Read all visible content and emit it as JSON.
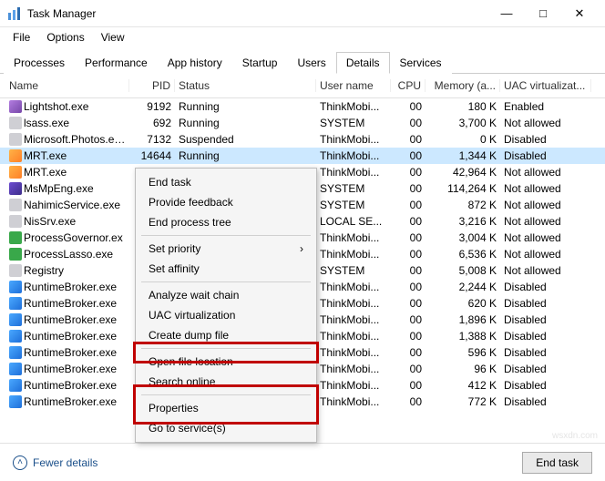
{
  "window": {
    "title": "Task Manager"
  },
  "win_buttons": {
    "min": "—",
    "max": "□",
    "close": "✕"
  },
  "menu": {
    "file": "File",
    "options": "Options",
    "view": "View"
  },
  "tabs": {
    "processes": "Processes",
    "performance": "Performance",
    "app_history": "App history",
    "startup": "Startup",
    "users": "Users",
    "details": "Details",
    "services": "Services"
  },
  "columns": {
    "name": "Name",
    "pid": "PID",
    "status": "Status",
    "user": "User name",
    "cpu": "CPU",
    "memory": "Memory (a...",
    "uac": "UAC virtualizat..."
  },
  "rows": [
    {
      "icon": "pen",
      "name": "Lightshot.exe",
      "pid": "9192",
      "status": "Running",
      "user": "ThinkMobi...",
      "cpu": "00",
      "mem": "180 K",
      "uac": "Enabled"
    },
    {
      "icon": "gry",
      "name": "lsass.exe",
      "pid": "692",
      "status": "Running",
      "user": "SYSTEM",
      "cpu": "00",
      "mem": "3,700 K",
      "uac": "Not allowed"
    },
    {
      "icon": "gry",
      "name": "Microsoft.Photos.exe",
      "pid": "7132",
      "status": "Suspended",
      "user": "ThinkMobi...",
      "cpu": "00",
      "mem": "0 K",
      "uac": "Disabled"
    },
    {
      "icon": "ora",
      "name": "MRT.exe",
      "pid": "14644",
      "status": "Running",
      "user": "ThinkMobi...",
      "cpu": "00",
      "mem": "1,344 K",
      "uac": "Disabled",
      "sel": true
    },
    {
      "icon": "ora",
      "name": "MRT.exe",
      "pid": "",
      "status": "",
      "user": "ThinkMobi...",
      "cpu": "00",
      "mem": "42,964 K",
      "uac": "Not allowed"
    },
    {
      "icon": "ppl",
      "name": "MsMpEng.exe",
      "pid": "",
      "status": "",
      "user": "SYSTEM",
      "cpu": "00",
      "mem": "114,264 K",
      "uac": "Not allowed"
    },
    {
      "icon": "gry",
      "name": "NahimicService.exe",
      "pid": "",
      "status": "",
      "user": "SYSTEM",
      "cpu": "00",
      "mem": "872 K",
      "uac": "Not allowed"
    },
    {
      "icon": "gry",
      "name": "NisSrv.exe",
      "pid": "",
      "status": "",
      "user": "LOCAL SE...",
      "cpu": "00",
      "mem": "3,216 K",
      "uac": "Not allowed"
    },
    {
      "icon": "grn",
      "name": "ProcessGovernor.ex",
      "pid": "",
      "status": "",
      "user": "ThinkMobi...",
      "cpu": "00",
      "mem": "3,004 K",
      "uac": "Not allowed"
    },
    {
      "icon": "grn",
      "name": "ProcessLasso.exe",
      "pid": "",
      "status": "",
      "user": "ThinkMobi...",
      "cpu": "00",
      "mem": "6,536 K",
      "uac": "Not allowed"
    },
    {
      "icon": "gry",
      "name": "Registry",
      "pid": "",
      "status": "",
      "user": "SYSTEM",
      "cpu": "00",
      "mem": "5,008 K",
      "uac": "Not allowed"
    },
    {
      "icon": "gear",
      "name": "RuntimeBroker.exe",
      "pid": "",
      "status": "",
      "user": "ThinkMobi...",
      "cpu": "00",
      "mem": "2,244 K",
      "uac": "Disabled"
    },
    {
      "icon": "gear",
      "name": "RuntimeBroker.exe",
      "pid": "",
      "status": "",
      "user": "ThinkMobi...",
      "cpu": "00",
      "mem": "620 K",
      "uac": "Disabled"
    },
    {
      "icon": "gear",
      "name": "RuntimeBroker.exe",
      "pid": "",
      "status": "",
      "user": "ThinkMobi...",
      "cpu": "00",
      "mem": "1,896 K",
      "uac": "Disabled"
    },
    {
      "icon": "gear",
      "name": "RuntimeBroker.exe",
      "pid": "",
      "status": "",
      "user": "ThinkMobi...",
      "cpu": "00",
      "mem": "1,388 K",
      "uac": "Disabled"
    },
    {
      "icon": "gear",
      "name": "RuntimeBroker.exe",
      "pid": "",
      "status": "",
      "user": "ThinkMobi...",
      "cpu": "00",
      "mem": "596 K",
      "uac": "Disabled"
    },
    {
      "icon": "gear",
      "name": "RuntimeBroker.exe",
      "pid": "",
      "status": "",
      "user": "ThinkMobi...",
      "cpu": "00",
      "mem": "96 K",
      "uac": "Disabled"
    },
    {
      "icon": "gear",
      "name": "RuntimeBroker.exe",
      "pid": "",
      "status": "",
      "user": "ThinkMobi...",
      "cpu": "00",
      "mem": "412 K",
      "uac": "Disabled"
    },
    {
      "icon": "gear",
      "name": "RuntimeBroker.exe",
      "pid": "",
      "status": "",
      "user": "ThinkMobi...",
      "cpu": "00",
      "mem": "772 K",
      "uac": "Disabled"
    }
  ],
  "context_menu": {
    "end_task": "End task",
    "feedback": "Provide feedback",
    "end_tree": "End process tree",
    "set_priority": "Set priority",
    "set_affinity": "Set affinity",
    "analyze": "Analyze wait chain",
    "uac_virt": "UAC virtualization",
    "dump": "Create dump file",
    "open_loc": "Open file location",
    "search": "Search online",
    "properties": "Properties",
    "services": "Go to service(s)"
  },
  "footer": {
    "fewer": "Fewer details",
    "end_task": "End task"
  },
  "watermark": "wsxdn.com"
}
